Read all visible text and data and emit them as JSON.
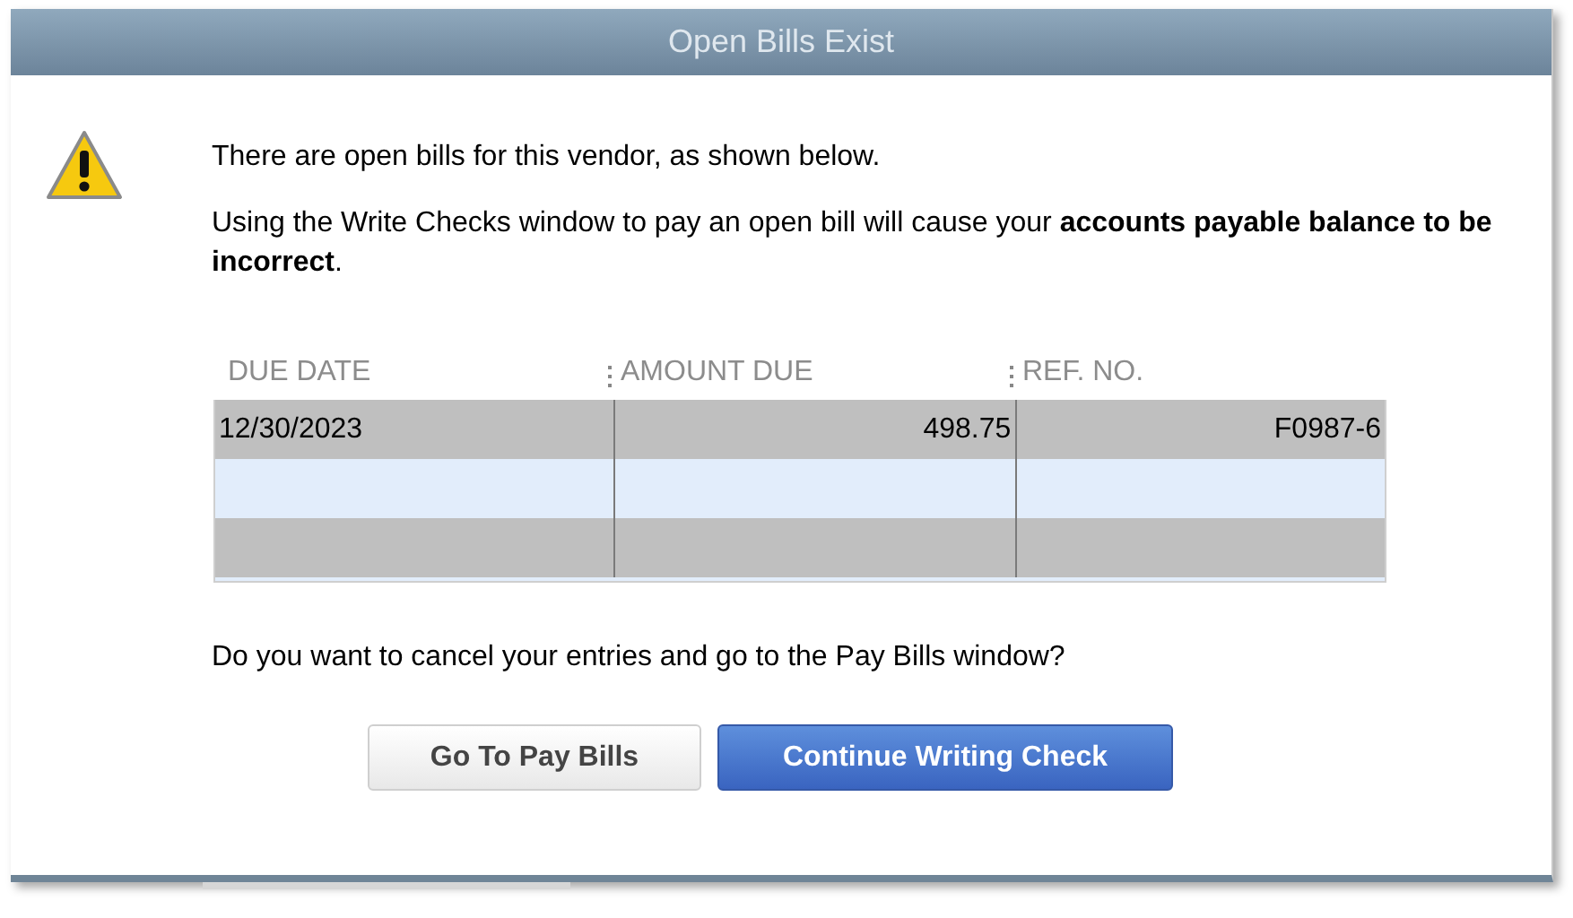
{
  "window": {
    "title": "Open Bills Exist"
  },
  "message": "There are open bills for this vendor, as shown below.",
  "warning": "Using the Write Checks window to pay an open bill will cause your **accounts payable balance to be incorrect**.",
  "table": {
    "columns": [
      {
        "label": "DUE DATE"
      },
      {
        "label": "AMOUNT DUE"
      },
      {
        "label": "REF. NO."
      }
    ],
    "rows": [
      [
        "12/30/2023",
        "498.75",
        "F0987-6"
      ]
    ]
  },
  "question": "Do you want to cancel your entries and go to the Pay Bills window?",
  "buttons": [
    {
      "label": "Go To Pay Bills",
      "kind": "secondary"
    },
    {
      "label": "Continue Writing Check",
      "kind": "primary"
    }
  ]
}
